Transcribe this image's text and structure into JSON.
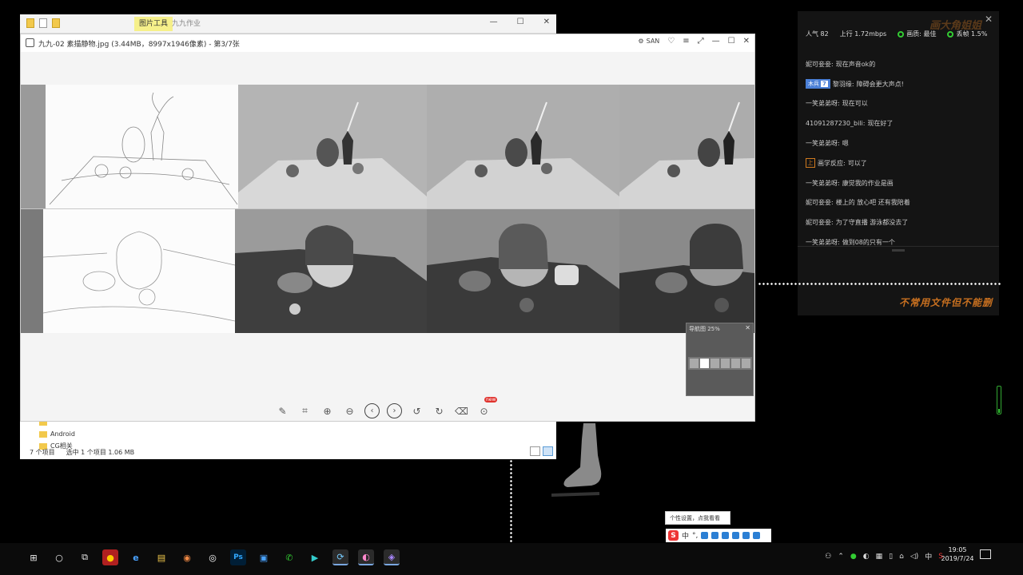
{
  "explorer": {
    "ribbon_tab_active": "图片工具",
    "ribbon_tab_title": "九九作业",
    "window_min": "—",
    "window_max": "☐",
    "window_close": "✕",
    "tree": [
      {
        "label": ""
      },
      {
        "label": "Android"
      },
      {
        "label": "CG相关"
      }
    ],
    "status_count": "7 个项目",
    "status_selected": "选中 1 个项目  1.06 MB"
  },
  "viewer": {
    "title": "九九-02 素描静物.jpg (3.44MB，8997x1946像素) - 第3/7张",
    "san_label": "SAN",
    "toolbar": [
      {
        "name": "edit-icon",
        "glyph": "✎"
      },
      {
        "name": "crop-icon",
        "glyph": "⌗"
      },
      {
        "name": "zoom-in-icon",
        "glyph": "⊕"
      },
      {
        "name": "zoom-out-icon",
        "glyph": "⊖"
      },
      {
        "name": "prev-icon",
        "glyph": "‹"
      },
      {
        "name": "next-icon",
        "glyph": "›"
      },
      {
        "name": "rotate-left-icon",
        "glyph": "↺"
      },
      {
        "name": "rotate-right-icon",
        "glyph": "↻"
      },
      {
        "name": "delete-icon",
        "glyph": "🗑"
      },
      {
        "name": "more-icon",
        "glyph": "⊙"
      }
    ],
    "new_badge": "new",
    "navigator_title": "导航图 25%",
    "navigator_close": "✕"
  },
  "chat": {
    "popularity_label": "人气",
    "popularity_value": "82",
    "upload_label": "上行",
    "upload_value": "1.72mbps",
    "quality_label": "画质: 最佳",
    "frame_label": "丢帧 1.5%",
    "brand": "画大角姐姐",
    "slogan": "不常用文件但不能删",
    "messages": [
      {
        "user": "妮可妾妾:",
        "text": "现在声音ok的",
        "badge": ""
      },
      {
        "user": "黎羽缘:",
        "text": "障碍会更大声点!",
        "badge": "木兵",
        "level": "7"
      },
      {
        "user": "一笑弟弟呀:",
        "text": "现在可以",
        "badge": ""
      },
      {
        "user": "41091287230_bili:",
        "text": "现在好了",
        "badge": ""
      },
      {
        "user": "一笑弟弟呀:",
        "text": "嗯",
        "badge": ""
      },
      {
        "user": "画学反应:",
        "text": "可以了",
        "badge": "box"
      },
      {
        "user": "一笑弟弟呀:",
        "text": "康觉我的作业是画",
        "badge": ""
      },
      {
        "user": "妮可妾妾:",
        "text": "楼上的 放心吧 还有我陪着",
        "badge": ""
      },
      {
        "user": "妮可妾妾:",
        "text": "为了守直播 游泳都没去了",
        "badge": ""
      },
      {
        "user": "一笑弟弟呀:",
        "text": "做到08的只有一个",
        "badge": ""
      }
    ]
  },
  "ime": {
    "tip": "个性设置，点我看看",
    "logo": "S",
    "mode": "中"
  },
  "taskbar": {
    "apps": [
      "⊞",
      "○",
      "⧉",
      "●",
      "e",
      "▤",
      "◉",
      "◎",
      "Ps",
      "▣",
      "✆",
      "▶",
      "⟳",
      "◐",
      "◈"
    ],
    "tray_lang": "中",
    "time": "19:05",
    "date": "2019/7/24"
  }
}
